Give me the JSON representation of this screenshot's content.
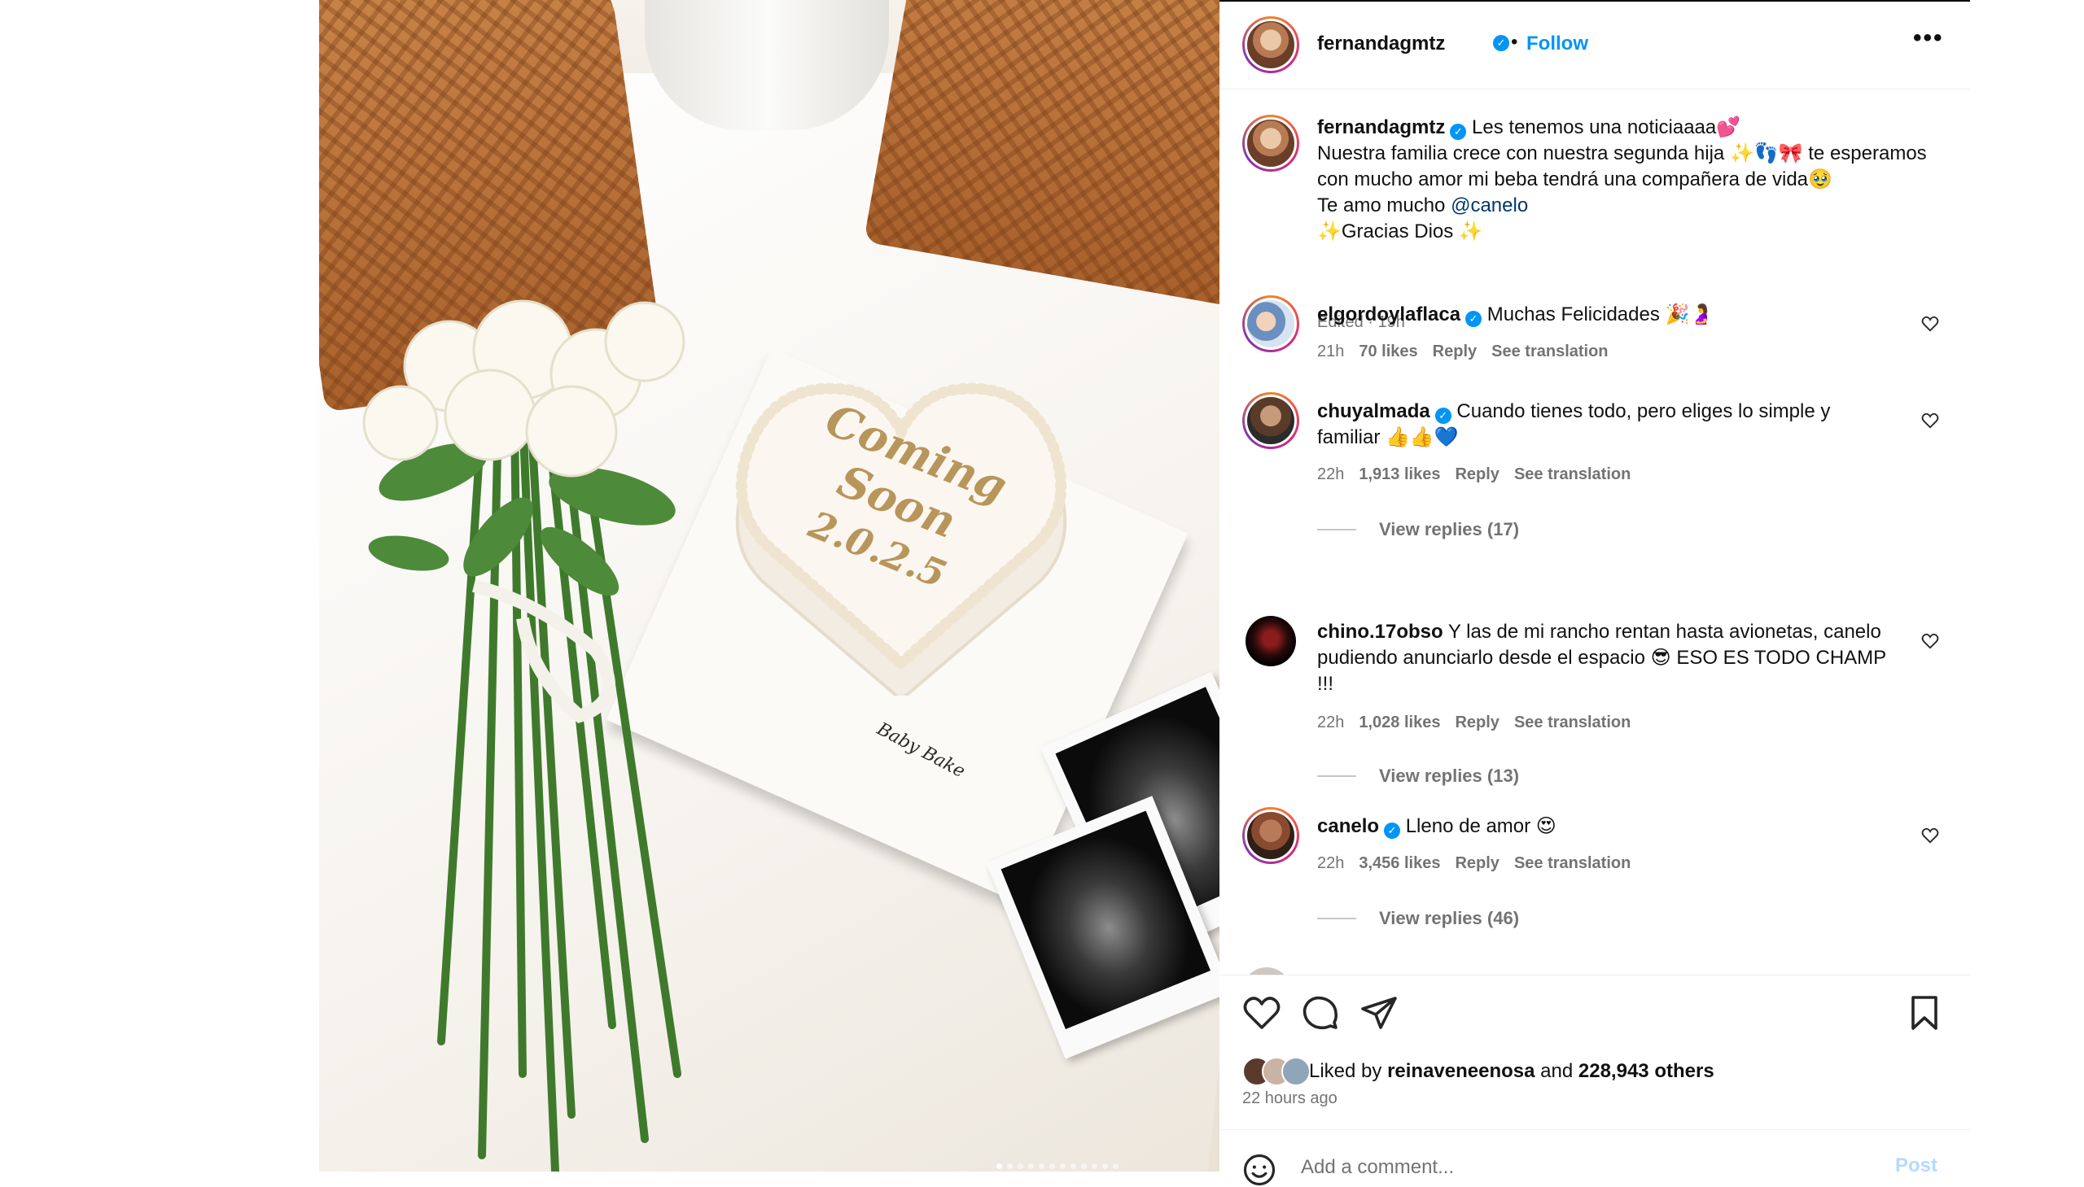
{
  "post": {
    "author": "fernandagmtz",
    "follow_label": "Follow",
    "dot_separator": "•",
    "more_glyph": "•••",
    "verified_glyph": "✓",
    "photo": {
      "cake_line1": "Coming",
      "cake_line2": "Soon",
      "cake_line3": "2.0.2.5",
      "board_signature": "Baby Bake",
      "next_glyph": "›",
      "carousel_dots": 12,
      "active_dot": 0
    },
    "caption": {
      "username": "fernandagmtz",
      "line1": "Les tenemos una noticiaaaa💕",
      "line2": "Nuestra familia crece con nuestra segunda hija ✨👣🎀 te esperamos con mucho amor mi beba tendrá una compañera de vida🥹",
      "line3_prefix": "Te amo mucho ",
      "line3_mention": "@canelo",
      "line4": "✨Gracias Dios ✨",
      "edited": "Edited · 19h"
    },
    "comments": [
      {
        "username": "elgordoylaflaca",
        "text": "Muchas Felicidades 🎉🤰",
        "time": "21h",
        "likes": "70 likes",
        "reply": "Reply",
        "translate": "See translation"
      },
      {
        "username": "chuyalmada",
        "text": "Cuando tienes todo, pero eliges lo simple y familiar 👍👍💙",
        "time": "22h",
        "likes": "1,913 likes",
        "reply": "Reply",
        "translate": "See translation",
        "view_replies": "View replies (17)"
      },
      {
        "username": "chino.17obso",
        "text": "Y las de mi rancho rentan hasta avionetas, canelo pudiendo anunciarlo desde el espacio 😎 ESO ES TODO CHAMP !!!",
        "time": "22h",
        "likes": "1,028 likes",
        "reply": "Reply",
        "translate": "See translation",
        "view_replies": "View replies (13)"
      },
      {
        "username": "canelo",
        "text": "Lleno de amor 😍",
        "time": "22h",
        "likes": "3,456 likes",
        "reply": "Reply",
        "translate": "See translation",
        "view_replies": "View replies (46)"
      }
    ],
    "likes": {
      "prefix": "Liked by ",
      "user": "reinaveneenosa",
      "middle": " and ",
      "others": "228,943 others"
    },
    "time_ago": "22 hours ago",
    "add_comment_placeholder": "Add a comment...",
    "post_label": "Post",
    "icons": {
      "like": "heart-icon",
      "comment": "comment-bubble-icon",
      "share": "paper-plane-icon",
      "save": "bookmark-icon",
      "emoji": "smiley-icon",
      "comment_like": "heart-outline-icon"
    },
    "colors": {
      "link_blue": "#0095f6",
      "mention": "#00376b",
      "meta_gray": "#737373",
      "post_disabled": "#b3dbff"
    }
  }
}
